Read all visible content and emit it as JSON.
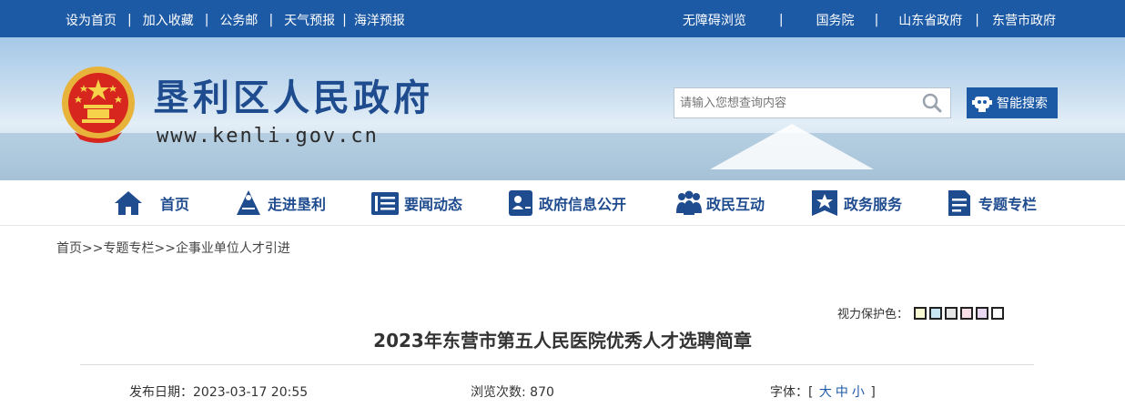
{
  "topbar": {
    "left_links": [
      "设为首页",
      "加入收藏",
      "公务邮",
      "天气预报",
      "海洋预报"
    ],
    "right_links": [
      "无障碍浏览",
      "国务院",
      "山东省政府",
      "东营市政府"
    ],
    "separator": "|"
  },
  "header": {
    "site_title": "垦利区人民政府",
    "site_url": "www.kenli.gov.cn",
    "search_placeholder": "请输入您想查询内容",
    "smart_search_label": "智能搜索"
  },
  "nav": {
    "items": [
      {
        "label": "首页",
        "icon": "home-icon"
      },
      {
        "label": "走进垦利",
        "icon": "landmark-icon"
      },
      {
        "label": "要闻动态",
        "icon": "news-icon"
      },
      {
        "label": "政府信息公开",
        "icon": "id-card-icon"
      },
      {
        "label": "政民互动",
        "icon": "people-icon"
      },
      {
        "label": "政务服务",
        "icon": "star-badge-icon"
      },
      {
        "label": "专题专栏",
        "icon": "document-icon"
      }
    ],
    "color": "#1f4b8f"
  },
  "breadcrumb": {
    "items": [
      "首页",
      "专题专栏",
      "企事业单位人才引进"
    ],
    "separator": ">>"
  },
  "vision": {
    "label": "视力保护色：",
    "colors": [
      "#fafad2",
      "#c6e6f5",
      "#e6e6e6",
      "#f9e0e6",
      "#e8d8f0",
      "#ffffff"
    ]
  },
  "article": {
    "title": "2023年东营市第五人民医院优秀人才选聘简章",
    "publish_label": "发布日期：",
    "publish_date": "2023-03-17 20:55",
    "views_label": "浏览次数: ",
    "views": "870",
    "font_label": "字体：",
    "font_open": "[",
    "font_sizes": [
      "大",
      "中",
      "小"
    ],
    "font_close": "]"
  },
  "colors": {
    "brand_blue": "#1d5aa6",
    "title_blue": "#1f4b8f"
  }
}
